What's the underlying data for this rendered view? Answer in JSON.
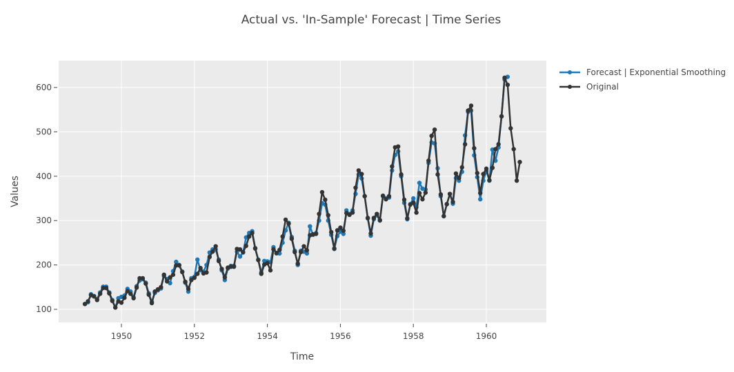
{
  "chart_data": {
    "type": "line",
    "title": "Actual vs. 'In-Sample' Forecast | Time Series",
    "xlabel": "Time",
    "ylabel": "Values",
    "xlim": [
      1948.7,
      1962.0
    ],
    "ylim": [
      70,
      655
    ],
    "xticks": [
      1950,
      1952,
      1954,
      1956,
      1958,
      1960
    ],
    "xtick_labels": [
      "1950",
      "1952",
      "1954",
      "1956",
      "1958",
      "1960"
    ],
    "yticks": [
      100,
      200,
      300,
      400,
      500,
      600
    ],
    "ytick_labels": [
      "100",
      "200",
      "300",
      "400",
      "500",
      "600"
    ],
    "grid": true,
    "legend_position": "top-right-outside",
    "x_start": 1949.0,
    "x_step": 0.0833333,
    "series": [
      {
        "name": "Forecast | Exponential Smoothing",
        "color": "#1f77b4",
        "values": [
          112,
          116,
          134,
          130,
          123,
          138,
          151,
          151,
          138,
          121,
          104,
          125,
          128,
          131,
          146,
          140,
          127,
          152,
          165,
          168,
          160,
          136,
          117,
          137,
          143,
          147,
          175,
          168,
          159,
          186,
          207,
          200,
          185,
          160,
          140,
          170,
          173,
          212,
          188,
          185,
          200,
          228,
          235,
          235,
          212,
          188,
          166,
          192,
          198,
          198,
          230,
          219,
          228,
          262,
          272,
          276,
          238,
          212,
          183,
          209,
          208,
          206,
          240,
          226,
          226,
          250,
          278,
          295,
          263,
          232,
          200,
          232,
          230,
          226,
          287,
          268,
          272,
          300,
          339,
          336,
          300,
          268,
          236,
          265,
          275,
          270,
          323,
          315,
          323,
          360,
          404,
          395,
          355,
          305,
          266,
          303,
          312,
          300,
          355,
          350,
          352,
          413,
          448,
          456,
          400,
          340,
          303,
          337,
          350,
          330,
          385,
          372,
          370,
          430,
          476,
          474,
          418,
          355,
          310,
          337,
          360,
          338,
          396,
          390,
          410,
          492,
          545,
          548,
          447,
          398,
          348,
          390,
          412,
          390,
          460,
          435,
          465,
          535,
          618,
          624
        ]
      },
      {
        "name": "Original",
        "color": "#333333",
        "values": [
          112,
          118,
          132,
          129,
          121,
          135,
          148,
          148,
          136,
          119,
          104,
          118,
          115,
          126,
          141,
          135,
          125,
          149,
          170,
          170,
          158,
          133,
          114,
          140,
          145,
          150,
          178,
          163,
          172,
          178,
          199,
          199,
          184,
          162,
          146,
          166,
          171,
          180,
          193,
          181,
          183,
          218,
          230,
          242,
          209,
          191,
          172,
          194,
          196,
          196,
          236,
          235,
          229,
          243,
          264,
          272,
          237,
          211,
          180,
          201,
          204,
          188,
          235,
          227,
          234,
          264,
          302,
          293,
          259,
          229,
          203,
          229,
          242,
          233,
          267,
          269,
          270,
          315,
          364,
          347,
          312,
          274,
          237,
          278,
          284,
          277,
          317,
          313,
          318,
          374,
          413,
          405,
          355,
          306,
          271,
          306,
          315,
          301,
          356,
          348,
          355,
          422,
          465,
          467,
          404,
          347,
          305,
          336,
          340,
          318,
          362,
          348,
          363,
          435,
          491,
          505,
          404,
          359,
          310,
          337,
          360,
          342,
          406,
          396,
          420,
          472,
          548,
          559,
          463,
          407,
          362,
          405,
          417,
          391,
          419,
          461,
          472,
          535,
          622,
          606,
          508,
          461,
          390,
          432
        ]
      }
    ]
  }
}
